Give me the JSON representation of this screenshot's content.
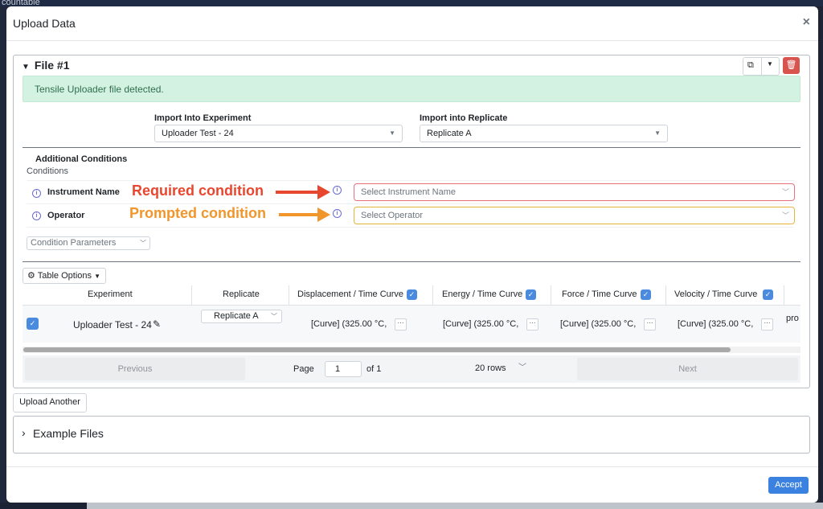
{
  "background": {
    "app_text": "countable"
  },
  "modal": {
    "title": "Upload Data",
    "close": "×"
  },
  "file": {
    "title": "File #1",
    "alert": "Tensile Uploader file detected.",
    "import_experiment_label": "Import Into Experiment",
    "import_experiment_value": "Uploader Test - 24",
    "import_replicate_label": "Import into Replicate",
    "import_replicate_value": "Replicate A",
    "additional_conditions": "Additional Conditions",
    "conditions_label": "Conditions",
    "conditions": [
      {
        "name": "Instrument Name",
        "placeholder": "Select Instrument Name"
      },
      {
        "name": "Operator",
        "placeholder": "Select Operator"
      }
    ],
    "annotations": {
      "required": "Required condition",
      "prompted": "Prompted condition"
    },
    "condition_parameters": "Condition Parameters"
  },
  "table": {
    "options_label": "Table Options",
    "headers": [
      "Experiment",
      "Replicate",
      "Displacement / Time Curve",
      "Energy / Time Curve",
      "Force / Time Curve",
      "Velocity / Time Curve"
    ],
    "row": {
      "experiment": "Uploader Test - 24",
      "replicate": "Replicate A",
      "displacement": "[Curve] (325.00 °C,",
      "energy": "[Curve] (325.00 °C,",
      "force": "[Curve] (325.00 °C,",
      "velocity": "[Curve] (325.00 °C,",
      "overflow": "pro"
    },
    "more": "···"
  },
  "pager": {
    "previous": "Previous",
    "page_label": "Page",
    "page_value": "1",
    "of_label": "of 1",
    "rows": "20 rows",
    "next": "Next"
  },
  "actions": {
    "upload_another": "Upload Another",
    "example_files": "Example Files",
    "accept": "Accept"
  },
  "colors": {
    "required": "#e8472f",
    "prompted": "#f0962b",
    "accent": "#3b82e0",
    "delete": "#d9534f"
  }
}
